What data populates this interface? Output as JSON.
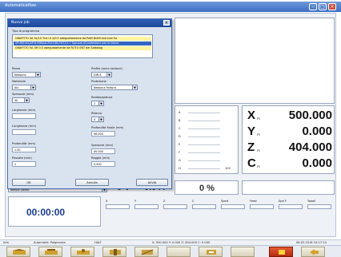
{
  "app": {
    "title": "Automaticaflow",
    "window_controls": {
      "minimize": "–",
      "maximize": "□",
      "close": "×"
    }
  },
  "readouts": {
    "axes": [
      {
        "letter": "X",
        "sub": "m",
        "value": "500.000"
      },
      {
        "letter": "Y",
        "sub": "m",
        "value": "0.000"
      },
      {
        "letter": "Z",
        "sub": "m",
        "value": "404.000"
      },
      {
        "letter": "C",
        "sub": "m",
        "value": "0.000"
      }
    ],
    "speed_left": "0 V",
    "speed_mid": "0.0 A",
    "percent": "0 %",
    "timer": "00:00:00",
    "channel_labels": [
      "A",
      "B",
      "C",
      "D",
      "E",
      "F",
      "G",
      "H"
    ],
    "channel_last_value": "100",
    "bottom_field_labels": [
      "X",
      "Y",
      "Z",
      "C",
      "Sped",
      "Feed",
      "Spd F",
      "Toooll"
    ],
    "left_combo": "Nessun pezzo"
  },
  "dialog": {
    "title": "Nuovo job",
    "list_label": "Tipo di programma",
    "list_rows": [
      "GRAFFITO 5A 3c/10 Tr:tri 0.1/0.5 adeguatamente da RAM DIAM end tool 5a",
      "SPURIOUS/AP:6-RRBAD-R3ChDk-FAT-01.7 Spruzzo di protezione per la faccia",
      "GRAFFITO 5A 3M 0.5 adeguatamente da ROTO ENT del Sottotag"
    ],
    "left_fields": [
      {
        "label": "Pezzo",
        "value": "Nessuno"
      },
      {
        "label": "Materiale",
        "value": "Alu"
      },
      {
        "label": "Spessore (mm)",
        "value": "30"
      },
      {
        "label": "Larghezza (mm)",
        "value": ""
      },
      {
        "label": "Lunghezza (mm)",
        "value": ""
      },
      {
        "label": "Profondità (mm)",
        "value": "1.00"
      },
      {
        "label": "Passate (mm)",
        "value": "1"
      }
    ],
    "right_fields": [
      {
        "label": "Profilo (anno sezione)",
        "value": "DIN A"
      },
      {
        "label": "Protezione",
        "value": "Nessuna finitura"
      },
      {
        "label": "Raddoppiatura",
        "value": "2"
      },
      {
        "label": "Ritorno",
        "value": "4"
      },
      {
        "label": "Profondità finale (mm)",
        "value": "96.000"
      },
      {
        "label": "Spessore (mm)",
        "value": "40.000"
      },
      {
        "label": "Raggio (mm)",
        "value": "0.500"
      }
    ],
    "buttons": {
      "ok": "OK",
      "cancel": "Annulla",
      "start": "AVVIA"
    }
  },
  "statusbar": {
    "segments": [
      "Info",
      "Automatik: Polgenuda",
      "HALT",
      "X: 500.000  Y: 0.000  Z: 404.000  C: 0.000",
      "08.02.2016  10:17:14"
    ]
  },
  "toolbar": {
    "buttons": [
      "home-tool",
      "measure-tool",
      "probe-tool",
      "set-tool",
      "offset-tool",
      "empty-1",
      "empty-2",
      "empty-3",
      "stop-tool",
      "exit-tool"
    ]
  },
  "colors": {
    "accent": "#2d5fb8",
    "list_highlight": "#fff4a0",
    "list_selected": "#3465c4",
    "stop": "#d13a1a"
  }
}
